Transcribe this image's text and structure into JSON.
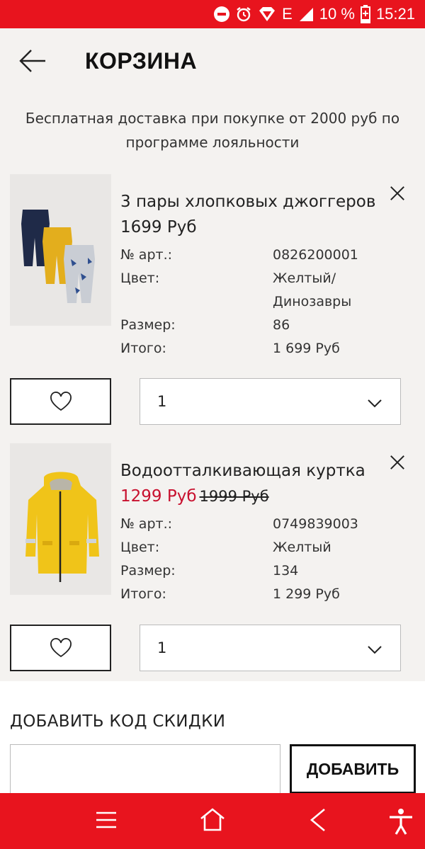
{
  "status_bar": {
    "network": "E",
    "battery": "10 %",
    "time": "15:21"
  },
  "header": {
    "title": "КОРЗИНА"
  },
  "promo": {
    "text": "Бесплатная доставка при покупке от 2000 руб по программе лояльности"
  },
  "items": [
    {
      "name": "3 пары хлопковых джоггеров",
      "price": "1699 Руб",
      "sale_price": "",
      "old_price": "",
      "art_label": "№ арт.:",
      "art_value": "0826200001",
      "color_label": "Цвет:",
      "color_value_line1": "Желтый/",
      "color_value_line2": "Динозавры",
      "size_label": "Размер:",
      "size_value": "86",
      "total_label": "Итого:",
      "total_value": "1 699 Руб",
      "quantity": "1"
    },
    {
      "name": "Водоотталкивающая куртка",
      "price": "",
      "sale_price": "1299 Руб",
      "old_price": "1999 Руб",
      "art_label": "№ арт.:",
      "art_value": "0749839003",
      "color_label": "Цвет:",
      "color_value_line1": "Желтый",
      "color_value_line2": "",
      "size_label": "Размер:",
      "size_value": "134",
      "total_label": "Итого:",
      "total_value": "1 299 Руб",
      "quantity": "1"
    }
  ],
  "discount": {
    "title": "ДОБАВИТЬ КОД СКИДКИ",
    "input_value": "",
    "button_label": "ДОБАВИТЬ"
  },
  "colors": {
    "brand_red": "#e8141e",
    "sale_red": "#c8102e",
    "background": "#f4f2f0"
  }
}
